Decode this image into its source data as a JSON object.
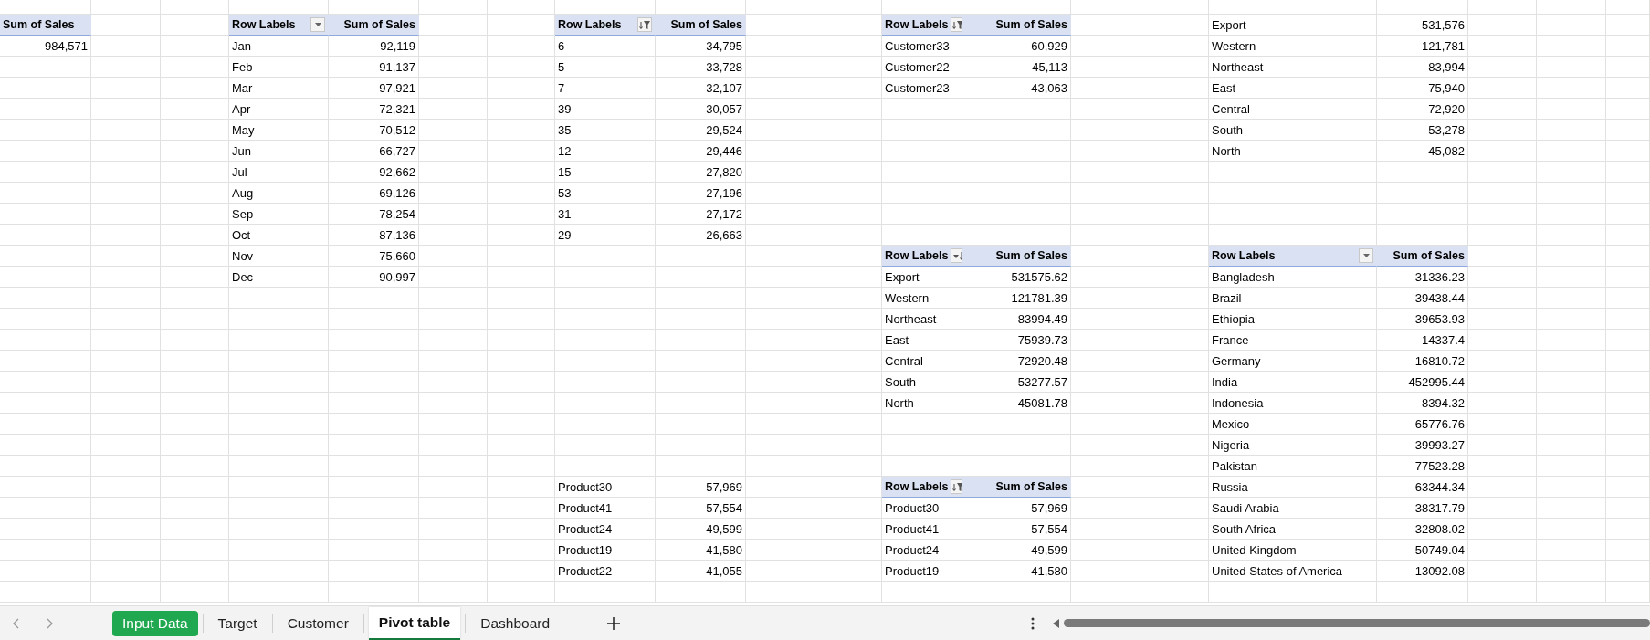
{
  "grand_total": {
    "header": "Sum of Sales",
    "value": "984,571"
  },
  "pivot_tables": [
    {
      "kind": "dropdown",
      "row_header": "Row Labels",
      "value_header": "Sum of Sales",
      "rows": [
        {
          "label": "Jan",
          "value": "92,119"
        },
        {
          "label": "Feb",
          "value": "91,137"
        },
        {
          "label": "Mar",
          "value": "97,921"
        },
        {
          "label": "Apr",
          "value": "72,321"
        },
        {
          "label": "May",
          "value": "70,512"
        },
        {
          "label": "Jun",
          "value": "66,727"
        },
        {
          "label": "Jul",
          "value": "92,662"
        },
        {
          "label": "Aug",
          "value": "69,126"
        },
        {
          "label": "Sep",
          "value": "78,254"
        },
        {
          "label": "Oct",
          "value": "87,136"
        },
        {
          "label": "Nov",
          "value": "75,660"
        },
        {
          "label": "Dec",
          "value": "90,997"
        }
      ]
    },
    {
      "kind": "sort-filter",
      "row_header": "Row Labels",
      "value_header": "Sum of Sales",
      "rows": [
        {
          "label": "6",
          "value": "34,795"
        },
        {
          "label": "5",
          "value": "33,728"
        },
        {
          "label": "7",
          "value": "32,107"
        },
        {
          "label": "39",
          "value": "30,057"
        },
        {
          "label": "35",
          "value": "29,524"
        },
        {
          "label": "12",
          "value": "29,446"
        },
        {
          "label": "15",
          "value": "27,820"
        },
        {
          "label": "53",
          "value": "27,196"
        },
        {
          "label": "31",
          "value": "27,172"
        },
        {
          "label": "29",
          "value": "26,663"
        }
      ]
    },
    {
      "kind": "plain",
      "rows": [
        {
          "label": "Product30",
          "value": "57,969"
        },
        {
          "label": "Product41",
          "value": "57,554"
        },
        {
          "label": "Product24",
          "value": "49,599"
        },
        {
          "label": "Product19",
          "value": "41,580"
        },
        {
          "label": "Product22",
          "value": "41,055"
        }
      ]
    },
    {
      "kind": "sort-filter",
      "row_header": "Row Labels",
      "value_header": "Sum of Sales",
      "rows": [
        {
          "label": "Customer33",
          "value": "60,929"
        },
        {
          "label": "Customer22",
          "value": "45,113"
        },
        {
          "label": "Customer23",
          "value": "43,063"
        }
      ]
    },
    {
      "kind": "sort-desc",
      "row_header": "Row Labels",
      "value_header": "Sum of Sales",
      "rows": [
        {
          "label": "Export",
          "value": "531575.62"
        },
        {
          "label": "Western",
          "value": "121781.39"
        },
        {
          "label": "Northeast",
          "value": "83994.49"
        },
        {
          "label": "East",
          "value": "75939.73"
        },
        {
          "label": "Central",
          "value": "72920.48"
        },
        {
          "label": "South",
          "value": "53277.57"
        },
        {
          "label": "North",
          "value": "45081.78"
        }
      ]
    },
    {
      "kind": "sort-filter",
      "row_header": "Row Labels",
      "value_header": "Sum of Sales",
      "rows": [
        {
          "label": "Product30",
          "value": "57,969"
        },
        {
          "label": "Product41",
          "value": "57,554"
        },
        {
          "label": "Product24",
          "value": "49,599"
        },
        {
          "label": "Product19",
          "value": "41,580"
        }
      ]
    },
    {
      "kind": "plain",
      "rows": [
        {
          "label": "Export",
          "value": "531,576"
        },
        {
          "label": "Western",
          "value": "121,781"
        },
        {
          "label": "Northeast",
          "value": "83,994"
        },
        {
          "label": "East",
          "value": "75,940"
        },
        {
          "label": "Central",
          "value": "72,920"
        },
        {
          "label": "South",
          "value": "53,278"
        },
        {
          "label": "North",
          "value": "45,082"
        }
      ]
    },
    {
      "kind": "dropdown",
      "row_header": "Row Labels",
      "value_header": "Sum of Sales",
      "rows": [
        {
          "label": "Bangladesh",
          "value": "31336.23"
        },
        {
          "label": "Brazil",
          "value": "39438.44"
        },
        {
          "label": "Ethiopia",
          "value": "39653.93"
        },
        {
          "label": "France",
          "value": "14337.4"
        },
        {
          "label": "Germany",
          "value": "16810.72"
        },
        {
          "label": "India",
          "value": "452995.44"
        },
        {
          "label": "Indonesia",
          "value": "8394.32"
        },
        {
          "label": "Mexico",
          "value": "65776.76"
        },
        {
          "label": "Nigeria",
          "value": "39993.27"
        },
        {
          "label": "Pakistan",
          "value": "77523.28"
        },
        {
          "label": "Russia",
          "value": "63344.34"
        },
        {
          "label": "Saudi Arabia",
          "value": "38317.79"
        },
        {
          "label": "South Africa",
          "value": "32808.02"
        },
        {
          "label": "United Kingdom",
          "value": "50749.04"
        },
        {
          "label": "United States of America",
          "value": "13092.08"
        }
      ]
    }
  ],
  "sheet_tabs": [
    {
      "label": "Input Data",
      "selected": false,
      "color": "#1fa84f"
    },
    {
      "label": "Target",
      "selected": false
    },
    {
      "label": "Customer",
      "selected": false
    },
    {
      "label": "Pivot table",
      "selected": true
    },
    {
      "label": "Dashboard",
      "selected": false
    }
  ]
}
